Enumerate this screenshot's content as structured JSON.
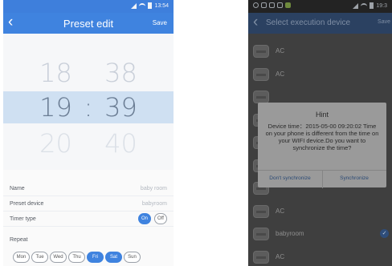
{
  "left_screen": {
    "status_bar": {
      "time": "13:54"
    },
    "header": {
      "back": "‹",
      "title": "Preset edit",
      "action": "Save"
    },
    "time_picker": {
      "above": {
        "hour": "18",
        "minute": "38"
      },
      "selected": {
        "hour": "19",
        "minute": "39",
        "separator": ":"
      },
      "below": {
        "hour": "20",
        "minute": "40"
      }
    },
    "fields": [
      {
        "label": "Name",
        "value": "baby room"
      },
      {
        "label": "Preset device",
        "value": "babyroom"
      }
    ],
    "timer_type": {
      "label": "Timer type",
      "on": "On",
      "off": "Off",
      "selected": "On"
    },
    "repeat": {
      "label": "Repeat",
      "days": [
        {
          "label": "Mon",
          "selected": false
        },
        {
          "label": "Tue",
          "selected": false
        },
        {
          "label": "Wed",
          "selected": false
        },
        {
          "label": "Thu",
          "selected": false
        },
        {
          "label": "Fri",
          "selected": true
        },
        {
          "label": "Sat",
          "selected": true
        },
        {
          "label": "Sun",
          "selected": false
        }
      ]
    },
    "colors": {
      "accent": "#3f83df",
      "picker_highlight": "#cfe0f2"
    }
  },
  "right_screen": {
    "status_bar": {
      "time": "19:3"
    },
    "header": {
      "back": "‹",
      "title": "Select execution device",
      "action": "Save"
    },
    "devices": [
      {
        "name": "AC",
        "checked": false
      },
      {
        "name": "AC",
        "checked": false
      },
      {
        "name": "",
        "checked": false
      },
      {
        "name": "",
        "checked": false
      },
      {
        "name": "",
        "checked": false
      },
      {
        "name": "",
        "checked": false
      },
      {
        "name": "",
        "checked": false
      },
      {
        "name": "AC",
        "checked": false
      },
      {
        "name": "babyroom",
        "checked": true
      },
      {
        "name": "AC",
        "checked": false
      }
    ],
    "dialog": {
      "title": "Hint",
      "message": "Device time：2015-05-00 09:20:02 Time on your phone is different from the time on your WIFI device.Do you want to synchronize the time?",
      "cancel": "Don't synchronize",
      "confirm": "Synchronize"
    },
    "check_mark": "✓"
  }
}
